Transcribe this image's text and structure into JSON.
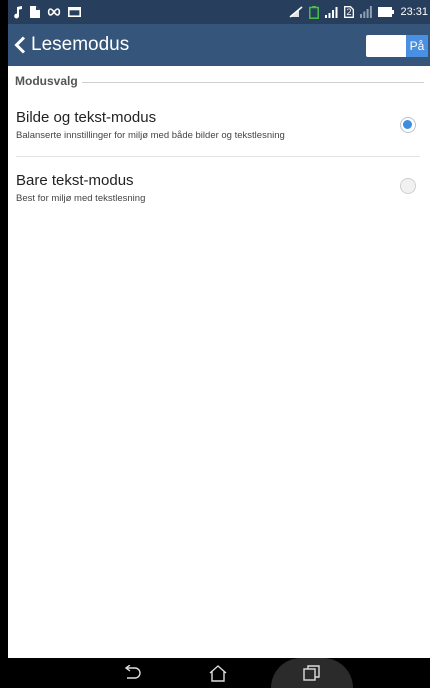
{
  "status_bar": {
    "time": "23:31",
    "sim_label": "2",
    "icons": [
      "music-note-icon",
      "file-icon",
      "infinity-icon",
      "screenshot-icon",
      "signal-off-icon",
      "battery-saver-icon",
      "signal-icon",
      "sim-icon",
      "wifi-icon",
      "battery-icon"
    ]
  },
  "app_bar": {
    "title": "Lesemodus",
    "toggle_label": "På",
    "toggle_on": true
  },
  "section": {
    "header": "Modusvalg",
    "options": [
      {
        "title": "Bilde og tekst-modus",
        "description": "Balanserte innstillinger for miljø med både bilder og tekstlesning",
        "selected": true
      },
      {
        "title": "Bare tekst-modus",
        "description": "Best for miljø med tekstlesning",
        "selected": false
      }
    ]
  },
  "nav_bar": {
    "icons": [
      "back-icon",
      "home-icon",
      "recent-apps-icon"
    ]
  },
  "colors": {
    "status_bar": "#273e5c",
    "app_bar": "#35557b",
    "accent": "#3b8ee0"
  }
}
